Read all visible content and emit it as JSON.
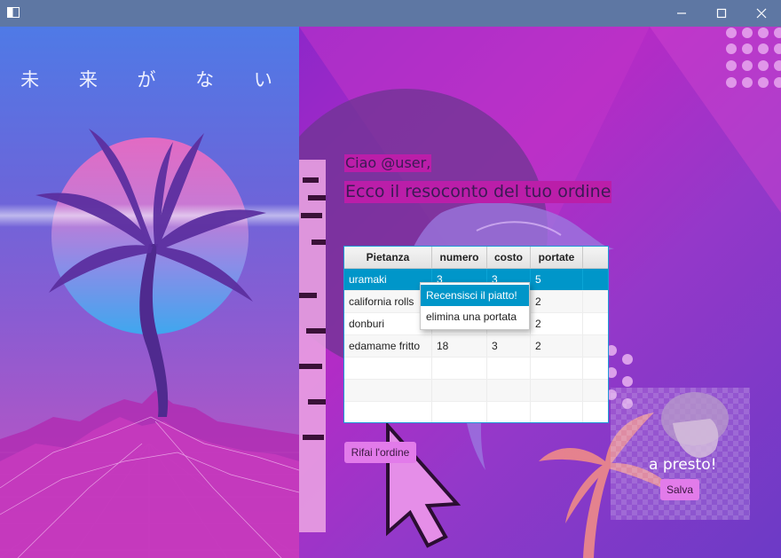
{
  "window": {
    "controls": {
      "minimize_icon": "minimize-icon",
      "maximize_icon": "maximize-icon",
      "close_icon": "close-icon"
    }
  },
  "art": {
    "left_title": "未 来 が な い"
  },
  "greeting": "Ciao @user,",
  "subtitle": "Ecco il resoconto del tuo ordine",
  "order_table": {
    "columns": [
      "Pietanza",
      "numero",
      "costo",
      "portate"
    ],
    "rows": [
      [
        "uramaki",
        "3",
        "3",
        "5"
      ],
      [
        "california rolls",
        "",
        "",
        "2"
      ],
      [
        "donburi",
        "",
        "",
        "2"
      ],
      [
        "edamame fritto",
        "18",
        "3",
        "2"
      ]
    ],
    "selected_row": 0
  },
  "context_menu": {
    "items": [
      "Recensisci il piatto!",
      "elimina una portata"
    ],
    "active_index": 0
  },
  "buttons": {
    "redo": "Rifai l'ordine",
    "save": "Salva"
  },
  "farewell": "a presto!",
  "colors": {
    "titlebar": "#5e77a3",
    "selection": "#0096c9",
    "button": "#e27bea",
    "text_highlight": "#bb1ea9"
  }
}
